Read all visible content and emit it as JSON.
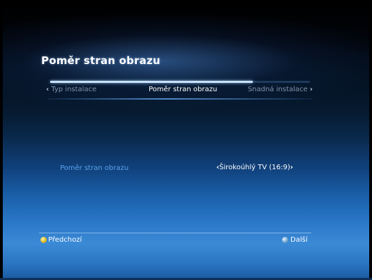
{
  "screen": {
    "title": "Poměr stran obrazu"
  },
  "wizard": {
    "progress": 0.78,
    "prev_label": "Typ instalace",
    "current_label": "Poměr stran obrazu",
    "next_label": "Snadná instalace",
    "prev_chevron": "‹",
    "next_chevron": "›"
  },
  "setting": {
    "label": "Poměr stran obrazu",
    "value": "Širokoúhlý TV (16:9)",
    "left_arrow": "‹",
    "right_arrow": "›"
  },
  "footer": {
    "prev_label": "Předchozí",
    "next_label": "Další",
    "prev_key_color": "#e8c83a",
    "next_key_color": "#8ab8e0"
  }
}
